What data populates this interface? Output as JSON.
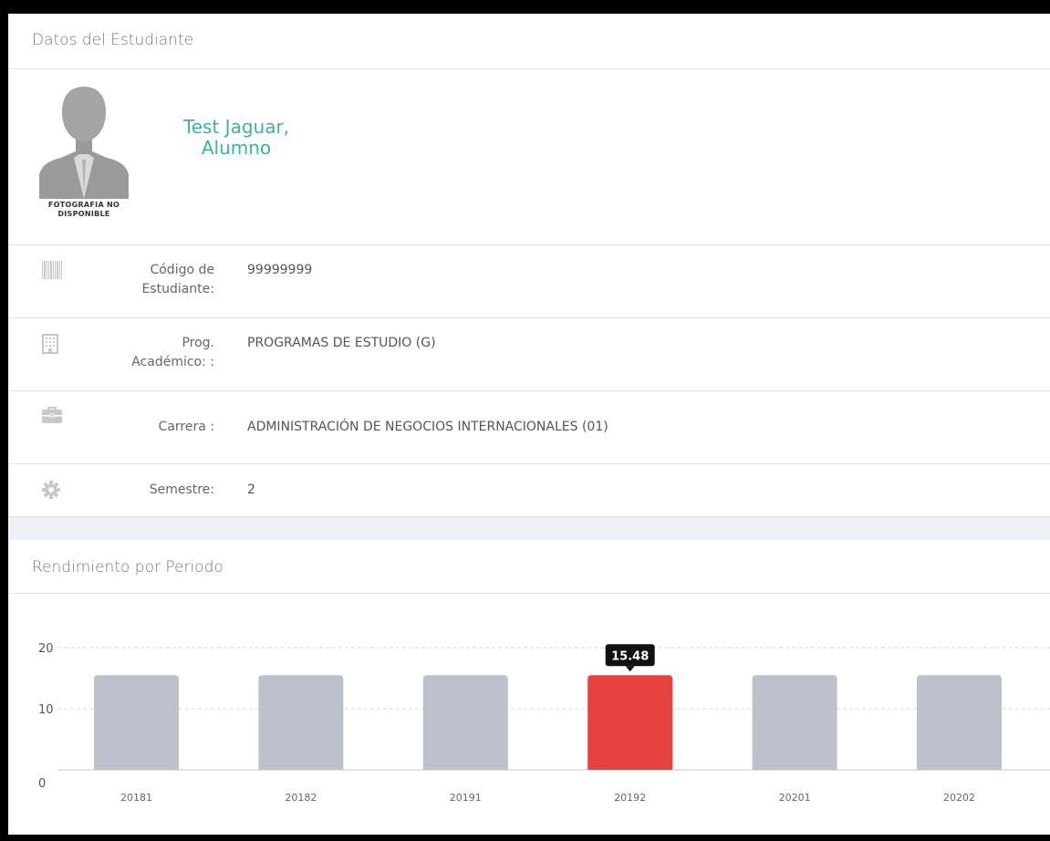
{
  "student_card": {
    "title": "Datos del Estudiante",
    "photo_caption_line1": "FOTOGRAFIA NO",
    "photo_caption_line2": "DISPONIBLE",
    "name_line1": "Test Jaguar,",
    "name_line2": "Alumno",
    "accent_color": "#3bb3a4"
  },
  "fields": [
    {
      "icon": "barcode-icon",
      "label_line1": "Código de",
      "label_line2": "Estudiante:",
      "value": "99999999"
    },
    {
      "icon": "building-icon",
      "label_line1": "Prog.",
      "label_line2": "Académico: :",
      "value": "PROGRAMAS DE ESTUDIO (G)"
    },
    {
      "icon": "briefcase-icon",
      "label_line1": "Carrera :",
      "label_line2": "",
      "value": "ADMINISTRACIÓN DE NEGOCIOS INTERNACIONALES (01)"
    },
    {
      "icon": "gear-icon",
      "label_line1": "Semestre:",
      "label_line2": "",
      "value": "2"
    }
  ],
  "performance_card": {
    "title": "Rendimiento por Periodo"
  },
  "chart_data": {
    "type": "bar",
    "title": "",
    "xlabel": "",
    "ylabel": "",
    "categories": [
      "20181",
      "20182",
      "20191",
      "20192",
      "20201",
      "20202"
    ],
    "values": [
      15.48,
      15.48,
      15.48,
      15.48,
      15.48,
      15.48
    ],
    "ylim": [
      0,
      20
    ],
    "yticks": [
      "0",
      "10",
      "20"
    ],
    "highlighted_index": 3,
    "tooltip": "15.48",
    "bar_color": "#bec1cc",
    "highlight_color": "#e84240",
    "grid": true
  }
}
